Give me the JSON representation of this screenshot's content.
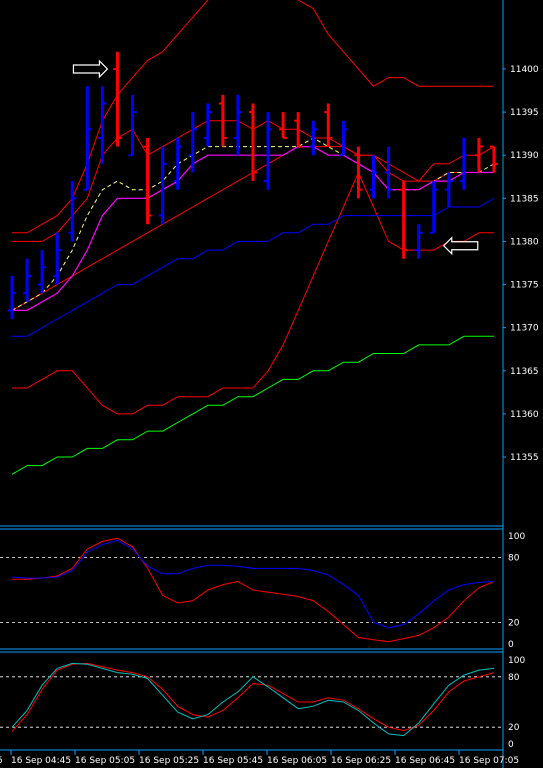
{
  "chart_data": [
    {
      "type": "ohlc",
      "panel": "main",
      "symbol": "",
      "ylim": [
        11347,
        11408
      ],
      "yticks": [
        "11400",
        "11395",
        "11390",
        "11385",
        "11380",
        "11375",
        "11370",
        "11365",
        "11360",
        "11355"
      ],
      "bars": [
        {
          "o": 11372,
          "h": 11376,
          "l": 11371,
          "c": 11374,
          "dir": "up"
        },
        {
          "o": 11374,
          "h": 11378,
          "l": 11373,
          "c": 11376,
          "dir": "up"
        },
        {
          "o": 11375,
          "h": 11379,
          "l": 11374,
          "c": 11377,
          "dir": "up"
        },
        {
          "o": 11376,
          "h": 11381,
          "l": 11375,
          "c": 11379,
          "dir": "up"
        },
        {
          "o": 11381,
          "h": 11387,
          "l": 11380,
          "c": 11385,
          "dir": "up"
        },
        {
          "o": 11386,
          "h": 11398,
          "l": 11386,
          "c": 11393,
          "dir": "up"
        },
        {
          "o": 11392,
          "h": 11398,
          "l": 11389,
          "c": 11396,
          "dir": "up"
        },
        {
          "o": 11400,
          "h": 11402,
          "l": 11391,
          "c": 11392,
          "dir": "down"
        },
        {
          "o": 11390,
          "h": 11397,
          "l": 11390,
          "c": 11395,
          "dir": "up"
        },
        {
          "o": 11391,
          "h": 11392,
          "l": 11382,
          "c": 11383,
          "dir": "down"
        },
        {
          "o": 11383,
          "h": 11391,
          "l": 11382,
          "c": 11389,
          "dir": "up"
        },
        {
          "o": 11387,
          "h": 11392,
          "l": 11386,
          "c": 11391,
          "dir": "up"
        },
        {
          "o": 11390,
          "h": 11395,
          "l": 11388,
          "c": 11393,
          "dir": "up"
        },
        {
          "o": 11392,
          "h": 11396,
          "l": 11391,
          "c": 11395,
          "dir": "up"
        },
        {
          "o": 11396,
          "h": 11397,
          "l": 11391,
          "c": 11392,
          "dir": "down"
        },
        {
          "o": 11392,
          "h": 11397,
          "l": 11390,
          "c": 11395,
          "dir": "up"
        },
        {
          "o": 11395,
          "h": 11396,
          "l": 11387,
          "c": 11388,
          "dir": "down"
        },
        {
          "o": 11387,
          "h": 11395,
          "l": 11386,
          "c": 11393,
          "dir": "up"
        },
        {
          "o": 11393,
          "h": 11395,
          "l": 11392,
          "c": 11392,
          "dir": "down"
        },
        {
          "o": 11394,
          "h": 11395,
          "l": 11391,
          "c": 11391,
          "dir": "down"
        },
        {
          "o": 11391,
          "h": 11394,
          "l": 11390,
          "c": 11393,
          "dir": "up"
        },
        {
          "o": 11395,
          "h": 11396,
          "l": 11391,
          "c": 11392,
          "dir": "down"
        },
        {
          "o": 11390,
          "h": 11394,
          "l": 11390,
          "c": 11393,
          "dir": "up"
        },
        {
          "o": 11390,
          "h": 11391,
          "l": 11385,
          "c": 11386,
          "dir": "down"
        },
        {
          "o": 11386,
          "h": 11390,
          "l": 11385,
          "c": 11388,
          "dir": "up"
        },
        {
          "o": 11388,
          "h": 11391,
          "l": 11385,
          "c": 11386,
          "dir": "up"
        },
        {
          "o": 11386,
          "h": 11387,
          "l": 11378,
          "c": 11379,
          "dir": "down"
        },
        {
          "o": 11379,
          "h": 11382,
          "l": 11378,
          "c": 11381,
          "dir": "up"
        },
        {
          "o": 11381,
          "h": 11387,
          "l": 11381,
          "c": 11386,
          "dir": "up"
        },
        {
          "o": 11386,
          "h": 11388,
          "l": 11384,
          "c": 11387,
          "dir": "up"
        },
        {
          "o": 11387,
          "h": 11392,
          "l": 11386,
          "c": 11390,
          "dir": "up"
        },
        {
          "o": 11390,
          "h": 11392,
          "l": 11388,
          "c": 11391,
          "dir": "down"
        },
        {
          "o": 11391,
          "h": 11391,
          "l": 11388,
          "c": 11389,
          "dir": "down"
        }
      ],
      "lines": {
        "upper_band": [
          11381,
          11381,
          11382,
          11383,
          11385,
          11389,
          11394,
          11397,
          11399,
          11401,
          11402,
          11404,
          11406,
          11408,
          11409,
          11410,
          11411,
          11410,
          11410,
          11408,
          11407,
          11404,
          11402,
          11400,
          11398,
          11399,
          11399,
          11398,
          11398,
          11398,
          11398,
          11398,
          11398
        ],
        "lower_band": [
          11363,
          11363,
          11364,
          11365,
          11365,
          11363,
          11361,
          11360,
          11360,
          11361,
          11361,
          11362,
          11362,
          11362,
          11363,
          11363,
          11363,
          11365,
          11368,
          11372,
          11376,
          11380,
          11384,
          11388,
          11384,
          11380,
          11379,
          11379,
          11379,
          11380,
          11380,
          11381,
          11381
        ],
        "outer_upper": [
          11380,
          11380,
          11380,
          11381,
          11383,
          11385,
          11390,
          11392,
          11393,
          11390,
          11391,
          11392,
          11393,
          11394,
          11394,
          11394,
          11393,
          11394,
          11393,
          11393,
          11392,
          11392,
          11391,
          11390,
          11390,
          11388,
          11387,
          11387,
          11389,
          11389,
          11390,
          11390,
          11391
        ],
        "outer_mid": [
          11372,
          11373,
          11374,
          11375,
          11376,
          11377,
          11378,
          11379,
          11380,
          11381,
          11382,
          11383,
          11384,
          11385,
          11386,
          11387,
          11388,
          11389,
          11390,
          11391,
          11391,
          11391,
          11391,
          11390,
          11390,
          11389,
          11388,
          11387,
          11387,
          11388,
          11388,
          11388,
          11388
        ],
        "dashed_ma": [
          11372,
          11373,
          11374,
          11376,
          11379,
          11383,
          11386,
          11387,
          11386,
          11386,
          11387,
          11389,
          11390,
          11391,
          11391,
          11391,
          11391,
          11391,
          11391,
          11391,
          11392,
          11391,
          11390,
          11389,
          11388,
          11386,
          11386,
          11386,
          11387,
          11388,
          11388,
          11388,
          11389
        ],
        "magenta_ma": [
          11372,
          11372,
          11373,
          11374,
          11376,
          11379,
          11383,
          11385,
          11385,
          11385,
          11386,
          11387,
          11389,
          11390,
          11390,
          11390,
          11390,
          11390,
          11390,
          11391,
          11391,
          11390,
          11390,
          11389,
          11388,
          11386,
          11386,
          11386,
          11387,
          11387,
          11388,
          11388,
          11388
        ],
        "blue_ma": [
          11369,
          11369,
          11370,
          11371,
          11372,
          11373,
          11374,
          11375,
          11375,
          11376,
          11377,
          11378,
          11378,
          11379,
          11379,
          11380,
          11380,
          11380,
          11381,
          11381,
          11382,
          11382,
          11383,
          11383,
          11383,
          11383,
          11383,
          11383,
          11383,
          11384,
          11384,
          11384,
          11385
        ],
        "green_ma": [
          11353,
          11354,
          11354,
          11355,
          11355,
          11356,
          11356,
          11357,
          11357,
          11358,
          11358,
          11359,
          11360,
          11361,
          11361,
          11362,
          11362,
          11363,
          11364,
          11364,
          11365,
          11365,
          11366,
          11366,
          11367,
          11367,
          11367,
          11368,
          11368,
          11368,
          11369,
          11369,
          11369
        ]
      },
      "arrows": [
        {
          "label": "",
          "bar": 7,
          "direction": "right",
          "y": 11400
        },
        {
          "label": "",
          "bar": 28,
          "direction": "left",
          "y": 11379.5
        }
      ]
    },
    {
      "type": "line",
      "panel": "oscillator1",
      "ylim": [
        0,
        100
      ],
      "yticks": [
        "100",
        "80",
        "20",
        "0"
      ],
      "levels": [
        80,
        20
      ],
      "series": [
        {
          "color": "#ff0000",
          "values": [
            60,
            60,
            61,
            63,
            70,
            88,
            95,
            98,
            90,
            70,
            45,
            38,
            40,
            50,
            55,
            58,
            50,
            48,
            46,
            44,
            40,
            30,
            18,
            6,
            4,
            2,
            5,
            8,
            15,
            25,
            40,
            52,
            58
          ]
        },
        {
          "color": "#0000ff",
          "values": [
            62,
            61,
            61,
            62,
            68,
            85,
            92,
            96,
            88,
            72,
            65,
            65,
            70,
            73,
            73,
            72,
            70,
            70,
            70,
            70,
            68,
            64,
            55,
            45,
            20,
            15,
            18,
            28,
            40,
            50,
            55,
            57,
            58
          ]
        }
      ]
    },
    {
      "type": "line",
      "panel": "oscillator2",
      "ylim": [
        0,
        100
      ],
      "yticks": [
        "100",
        "80",
        "20",
        "0"
      ],
      "levels": [
        80,
        20
      ],
      "series": [
        {
          "color": "#ff0000",
          "values": [
            15,
            35,
            65,
            88,
            95,
            96,
            92,
            88,
            85,
            80,
            65,
            45,
            35,
            32,
            40,
            55,
            72,
            70,
            60,
            50,
            50,
            55,
            52,
            42,
            30,
            20,
            16,
            22,
            40,
            62,
            75,
            80,
            85
          ]
        },
        {
          "color": "#00c0c0",
          "values": [
            20,
            40,
            70,
            90,
            96,
            95,
            90,
            85,
            83,
            78,
            58,
            38,
            30,
            35,
            50,
            62,
            80,
            68,
            55,
            42,
            45,
            52,
            50,
            40,
            25,
            12,
            10,
            25,
            48,
            70,
            82,
            88,
            90
          ]
        }
      ]
    }
  ],
  "time_labels": [
    "16 Sep 04:45",
    "16 Sep 05:05",
    "16 Sep 05:25",
    "16 Sep 05:45",
    "16 Sep 06:05",
    "16 Sep 06:25",
    "16 Sep 06:45",
    "16 Sep 07:05"
  ],
  "colors": {
    "up": "#0000ff",
    "down": "#ff0000",
    "axis": "#00a0ff",
    "grid": "#ffffff"
  }
}
